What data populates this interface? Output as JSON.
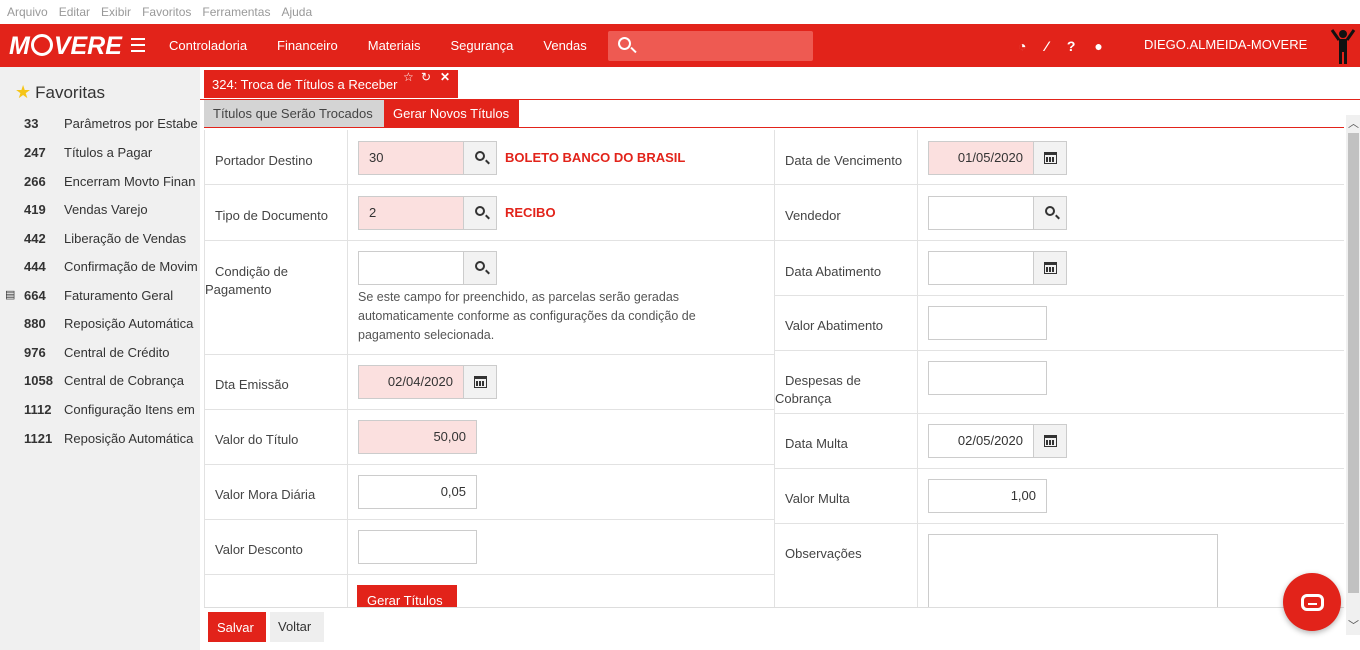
{
  "menu": [
    "Arquivo",
    "Editar",
    "Exibir",
    "Favoritos",
    "Ferramentas",
    "Ajuda"
  ],
  "brand": {
    "logo_text_1": "M",
    "logo_text_2": "VERE",
    "accent": "#e2231a"
  },
  "nav": [
    "Controladoria",
    "Financeiro",
    "Materiais",
    "Segurança",
    "Vendas"
  ],
  "search": {
    "placeholder": ""
  },
  "user": {
    "name": "DIEGO.ALMEIDA-MOVERE"
  },
  "sidebar": {
    "title": "Favoritas",
    "items": [
      {
        "num": "33",
        "label": "Parâmetros por Estabe"
      },
      {
        "num": "247",
        "label": "Títulos a Pagar"
      },
      {
        "num": "266",
        "label": "Encerram Movto Finan"
      },
      {
        "num": "419",
        "label": "Vendas Varejo"
      },
      {
        "num": "442",
        "label": "Liberação de Vendas"
      },
      {
        "num": "444",
        "label": "Confirmação de Movim"
      },
      {
        "num": "664",
        "label": "Faturamento Geral"
      },
      {
        "num": "880",
        "label": "Reposição Automática"
      },
      {
        "num": "976",
        "label": "Central de Crédito"
      },
      {
        "num": "1058",
        "label": "Central de Cobrança"
      },
      {
        "num": "1112",
        "label": "Configuração Itens em"
      },
      {
        "num": "1121",
        "label": "Reposição Automática"
      }
    ]
  },
  "window_tab": {
    "title": "324: Troca de Títulos a Receber"
  },
  "subtabs": [
    "Títulos que Serão Trocados",
    "Gerar Novos Títulos"
  ],
  "left_form": {
    "portador_label": "Portador Destino",
    "portador_value": "30",
    "portador_desc": "BOLETO BANCO DO BRASIL",
    "tipo_label": "Tipo de Documento",
    "tipo_value": "2",
    "tipo_desc": "RECIBO",
    "condicao_label_1": "Condição de",
    "condicao_label_2": "Pagamento",
    "condicao_value": "",
    "condicao_help": "Se este campo for preenchido, as parcelas serão geradas automaticamente conforme as configurações da condição de pagamento selecionada.",
    "emissao_label": "Dta Emissão",
    "emissao_value": "02/04/2020",
    "valor_label": "Valor do Título",
    "valor_value": "50,00",
    "mora_label": "Valor Mora Diária",
    "mora_value": "0,05",
    "desconto_label": "Valor Desconto",
    "desconto_value": "",
    "gerar_label": "Gerar Títulos"
  },
  "right_form": {
    "venc_label": "Data de Vencimento",
    "venc_value": "01/05/2020",
    "vendedor_label": "Vendedor",
    "vendedor_value": "",
    "abat_label": "Data Abatimento",
    "abat_value": "",
    "vabat_label": "Valor Abatimento",
    "vabat_value": "",
    "desp_label_1": "Despesas de",
    "desp_label_2": "Cobrança",
    "desp_value": "",
    "multa_label": "Data Multa",
    "multa_value": "02/05/2020",
    "vmulta_label": "Valor Multa",
    "vmulta_value": "1,00",
    "obs_label": "Observações",
    "obs_value": ""
  },
  "footer": {
    "save": "Salvar",
    "back": "Voltar"
  }
}
